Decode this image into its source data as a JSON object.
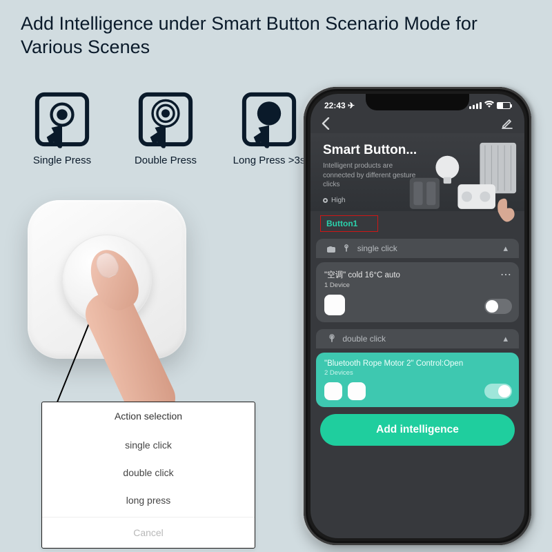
{
  "headline": "Add Intelligence under Smart Button Scenario Mode for Various Scenes",
  "press": {
    "single": "Single Press",
    "double": "Double Press",
    "long": "Long Press >3s"
  },
  "action_popup": {
    "title": "Action selection",
    "items": [
      "single click",
      "double click",
      "long press"
    ],
    "cancel": "Cancel"
  },
  "phone": {
    "status_time": "22:43",
    "hero": {
      "title": "Smart Button...",
      "subtitle": "Intelligent products are connected by different gesture clicks",
      "high_label": "High"
    },
    "button_tab": "Button1",
    "sections": {
      "single": {
        "label": "single click",
        "card_title": "\"空调\" cold 16°C auto",
        "card_sub": "1 Device"
      },
      "double": {
        "label": "double click",
        "card_title": "\"Bluetooth Rope Motor 2\" Control:Open",
        "card_sub": "2 Devices"
      }
    },
    "add_button": "Add intelligence"
  }
}
